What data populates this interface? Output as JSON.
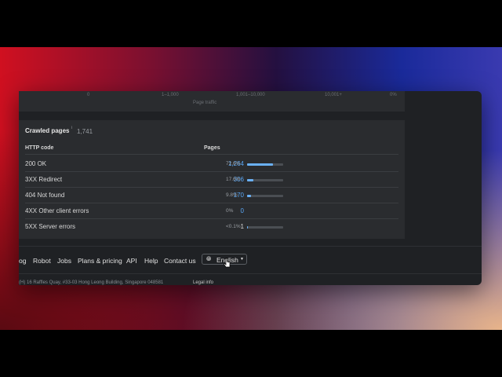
{
  "chart_tail": {
    "ticks": [
      "0",
      "1–1,000",
      "1,001–10,000",
      "10,001+",
      "0%"
    ],
    "axis_title": "Page traffic"
  },
  "crawled": {
    "title": "Crawled pages",
    "info_icon": "info-icon",
    "total": "1,741",
    "headers": {
      "code": "HTTP code",
      "pages": "Pages"
    },
    "rows": [
      {
        "label": "200 OK",
        "value": "1,264",
        "pct": "72.6%",
        "fill": 72.6
      },
      {
        "label": "3XX Redirect",
        "value": "306",
        "pct": "17.6%",
        "fill": 17.6
      },
      {
        "label": "404 Not found",
        "value": "170",
        "pct": "9.8%",
        "fill": 9.8
      },
      {
        "label": "4XX Other client errors",
        "value": "0",
        "pct": "0%",
        "fill": 0
      },
      {
        "label": "5XX Server errors",
        "value": "1",
        "pct": "<0.1%",
        "fill": 0.1
      }
    ],
    "bar_color": "#6ab0f5"
  },
  "footer": {
    "links": [
      "og",
      "Robot",
      "Jobs",
      "Plans & pricing",
      "API",
      "Help",
      "Contact us"
    ],
    "language": "English",
    "globe_icon": "globe-icon",
    "address": "(H) 16 Raffles Quay, #33-03 Hong Leong Building, Singapore 048581",
    "legal": "Legal info"
  }
}
